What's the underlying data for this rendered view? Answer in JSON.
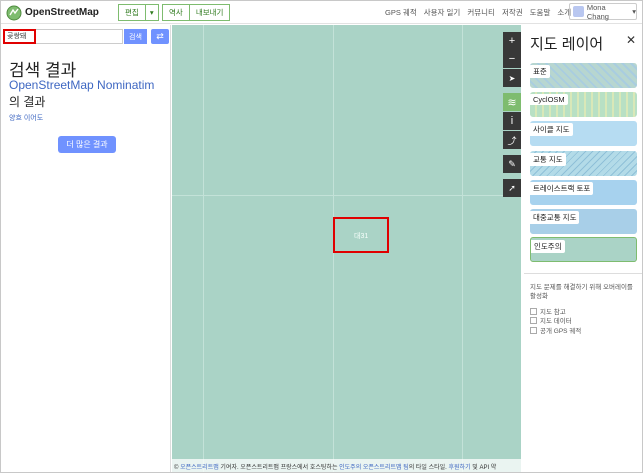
{
  "app": {
    "brand": "OpenStreetMap"
  },
  "header": {
    "edit_label": "편집",
    "edit_dropdown": "▾",
    "history_label": "역사",
    "export_label": "내보내기",
    "nav": [
      "GPS 궤적",
      "사용자 일기",
      "커뮤니티",
      "저작권",
      "도움말",
      "소개"
    ],
    "user_name": "Mona Chang",
    "user_caret": "▾"
  },
  "search": {
    "query": "곶쌍돼",
    "button_label": "검색",
    "directions_icon": "directions-icon"
  },
  "results": {
    "title": "검색 결과",
    "provider": "OpenStreetMap Nominatim",
    "provider_suffix": "의 결과",
    "small_link": "양흐 이어도",
    "more_button": "더 많은 결과"
  },
  "map": {
    "label": "대31",
    "attribution_prefix": "© ",
    "attribution_link1": "오픈스트리트맵",
    "attribution_mid": " 기여자. 오픈스트리트맵 프랑스에서 호스팅하는 ",
    "attribution_link2": "인도주의 오픈스트리트맵 팀",
    "attribution_mid2": "의 타일 스타일. ",
    "attribution_link3": "후원하기",
    "attribution_end": " 및 API 약"
  },
  "controls": [
    {
      "name": "zoom-in-icon",
      "glyph": "+"
    },
    {
      "name": "zoom-out-icon",
      "glyph": "−"
    },
    {
      "name": "locate-icon",
      "glyph": "➤"
    },
    {
      "name": "layers-icon",
      "glyph": "≋",
      "active": true
    },
    {
      "name": "info-icon",
      "glyph": "i"
    },
    {
      "name": "share-icon",
      "glyph": "⤴"
    },
    {
      "name": "note-icon",
      "glyph": "✎"
    },
    {
      "name": "query-icon",
      "glyph": "➚"
    }
  ],
  "layers_panel": {
    "title": "지도 레이어",
    "close": "✕",
    "layers": [
      {
        "label": "표준",
        "color": "#b7d6d0",
        "accent": "#9fc5e8"
      },
      {
        "label": "CyclOSM",
        "color": "#b8e0c4",
        "accent": "#e2d8b0"
      },
      {
        "label": "사이클 지도",
        "color": "#b6dcf2",
        "accent": "#a9d4ef"
      },
      {
        "label": "교통 지도",
        "color": "#b3dbe8",
        "accent": "#8fc0d8"
      },
      {
        "label": "트레이스트랙 토포",
        "color": "#a7d2ee",
        "accent": "#8ec2e6"
      },
      {
        "label": "대중교통 지도",
        "color": "#a8cfe8",
        "accent": "#a8cfe8"
      },
      {
        "label": "인도주의",
        "color": "#aad3c6",
        "accent": "#aad3c6",
        "selected": true
      }
    ],
    "note": "지도 문제를 해결하기 위해 오버레이를 활성화",
    "overlays": [
      "지도 참고",
      "지도 데이터",
      "공개 GPS 궤적"
    ]
  },
  "highlight_color": "#e00000",
  "accent_color": "#7092ff"
}
